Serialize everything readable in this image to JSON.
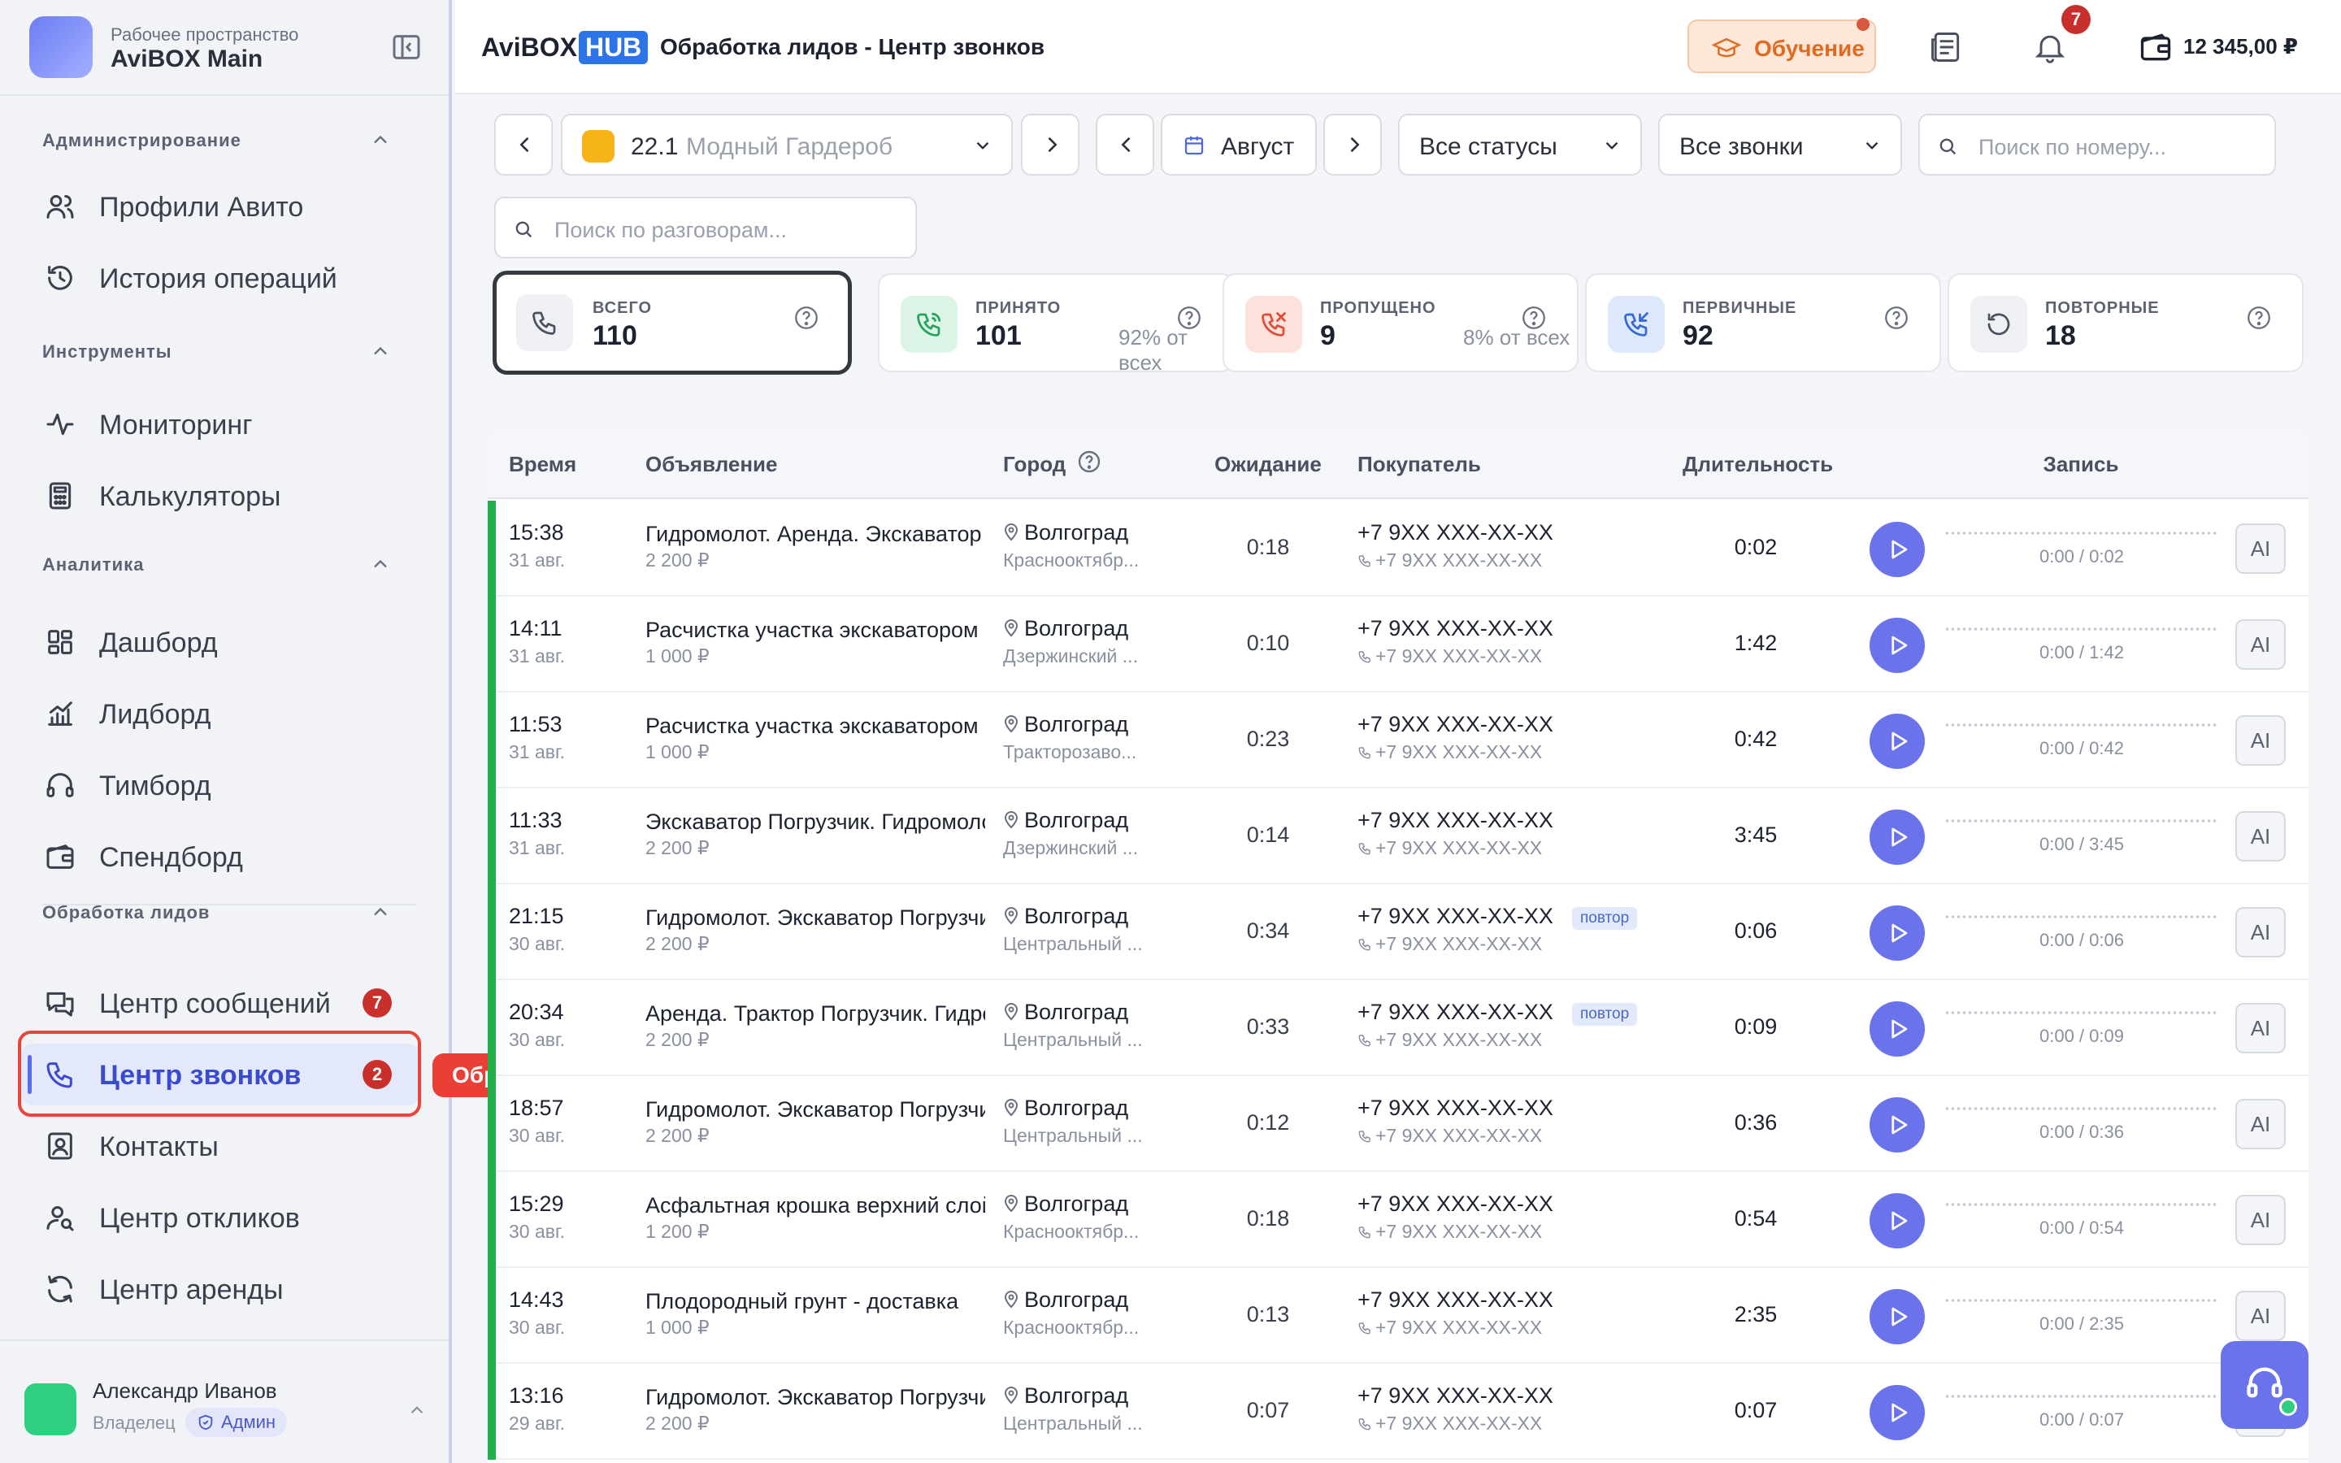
{
  "workspace": {
    "subtitle": "Рабочее пространство",
    "name": "AviBOX Main"
  },
  "sidebar": {
    "sections": [
      {
        "title": "Администрирование",
        "items": [
          {
            "label": "Профили Авито",
            "icon": "users-icon"
          },
          {
            "label": "История операций",
            "icon": "history-icon"
          }
        ]
      },
      {
        "title": "Инструменты",
        "items": [
          {
            "label": "Мониторинг",
            "icon": "activity-icon"
          },
          {
            "label": "Калькуляторы",
            "icon": "calculator-icon"
          }
        ]
      },
      {
        "title": "Аналитика",
        "items": [
          {
            "label": "Дашборд",
            "icon": "dashboard-icon"
          },
          {
            "label": "Лидборд",
            "icon": "chart-icon"
          },
          {
            "label": "Тимборд",
            "icon": "headphones-icon"
          },
          {
            "label": "Спендборд",
            "icon": "wallet-icon"
          }
        ]
      },
      {
        "title": "Обработка лидов",
        "items": [
          {
            "label": "Центр сообщений",
            "icon": "messages-icon",
            "badge": "7"
          },
          {
            "label": "Центр звонков",
            "icon": "phone-icon",
            "badge": "2",
            "active": true
          },
          {
            "label": "Контакты",
            "icon": "contacts-icon"
          },
          {
            "label": "Центр откликов",
            "icon": "user-search-icon"
          },
          {
            "label": "Центр аренды",
            "icon": "refresh-icon"
          }
        ]
      }
    ],
    "tooltip": "Обработка лидов → Звонки",
    "user": {
      "name": "Александр Иванов",
      "role": "Владелец",
      "badge": "Админ"
    }
  },
  "header": {
    "brand_left": "AviBOX",
    "brand_right": "HUB",
    "title": "Обработка лидов - Центр звонков",
    "learn_label": "Обучение",
    "notifications_count": "7",
    "balance": "12 345,00 ₽"
  },
  "filters": {
    "profile_code": "22.1",
    "profile_name": "Модный Гардероб",
    "month": "Август",
    "status": "Все статусы",
    "calls": "Все звонки",
    "phone_search_placeholder": "Поиск по номеру...",
    "conversation_search_placeholder": "Поиск по разговорам..."
  },
  "stats": [
    {
      "caption": "ВСЕГО",
      "value": "110",
      "pct": "",
      "color": "#eef0f4",
      "icon": "phone-icon",
      "iconColor": "#4a5060"
    },
    {
      "caption": "ПРИНЯТО",
      "value": "101",
      "pct": "92% от всех",
      "color": "#dcf5e6",
      "icon": "phone-in-icon",
      "iconColor": "#22a45a"
    },
    {
      "caption": "ПРОПУЩЕНО",
      "value": "9",
      "pct": "8% от всех",
      "color": "#fde2dc",
      "icon": "phone-missed-icon",
      "iconColor": "#e44b36"
    },
    {
      "caption": "ПЕРВИЧНЫЕ",
      "value": "92",
      "pct": "",
      "color": "#dde8fb",
      "icon": "phone-incoming-icon",
      "iconColor": "#3568d9"
    },
    {
      "caption": "ПОВТОРНЫЕ",
      "value": "18",
      "pct": "",
      "color": "#eef0f4",
      "icon": "repeat-icon",
      "iconColor": "#4a5060"
    }
  ],
  "table": {
    "columns": [
      "Время",
      "Объявление",
      "Город",
      "Ожидание",
      "Покупатель",
      "Длительность",
      "Запись"
    ],
    "ai_label": "AI",
    "repeat_label": "повтор",
    "rows": [
      {
        "time": "15:38",
        "date": "31 авг.",
        "ad": "Гидромолот. Аренда. Экскаватор",
        "price": "2 200 ₽",
        "city": "Волгоград",
        "district": "Краснооктябр...",
        "wait": "0:18",
        "phone": "+7 9XX XXX-XX-XX",
        "phone2": "+7 9XX XXX-XX-XX",
        "repeat": false,
        "duration": "0:02",
        "progress": "0:00 / 0:02"
      },
      {
        "time": "14:11",
        "date": "31 авг.",
        "ad": "Расчистка участка экскаватором",
        "price": "1 000 ₽",
        "city": "Волгоград",
        "district": "Дзержинский ...",
        "wait": "0:10",
        "phone": "+7 9XX XXX-XX-XX",
        "phone2": "+7 9XX XXX-XX-XX",
        "repeat": false,
        "duration": "1:42",
        "progress": "0:00 / 1:42"
      },
      {
        "time": "11:53",
        "date": "31 авг.",
        "ad": "Расчистка участка экскаватором",
        "price": "1 000 ₽",
        "city": "Волгоград",
        "district": "Тракторозаво...",
        "wait": "0:23",
        "phone": "+7 9XX XXX-XX-XX",
        "phone2": "+7 9XX XXX-XX-XX",
        "repeat": false,
        "duration": "0:42",
        "progress": "0:00 / 0:42"
      },
      {
        "time": "11:33",
        "date": "31 авг.",
        "ad": "Экскаватор Погрузчик. Гидромолот",
        "price": "2 200 ₽",
        "city": "Волгоград",
        "district": "Дзержинский ...",
        "wait": "0:14",
        "phone": "+7 9XX XXX-XX-XX",
        "phone2": "+7 9XX XXX-XX-XX",
        "repeat": false,
        "duration": "3:45",
        "progress": "0:00 / 3:45"
      },
      {
        "time": "21:15",
        "date": "30 авг.",
        "ad": "Гидромолот. Экскаватор Погрузчик",
        "price": "2 200 ₽",
        "city": "Волгоград",
        "district": "Центральный ...",
        "wait": "0:34",
        "phone": "+7 9XX XXX-XX-XX",
        "phone2": "+7 9XX XXX-XX-XX",
        "repeat": true,
        "duration": "0:06",
        "progress": "0:00 / 0:06"
      },
      {
        "time": "20:34",
        "date": "30 авг.",
        "ad": "Аренда. Трактор Погрузчик. Гидромолот",
        "price": "2 200 ₽",
        "city": "Волгоград",
        "district": "Центральный ...",
        "wait": "0:33",
        "phone": "+7 9XX XXX-XX-XX",
        "phone2": "+7 9XX XXX-XX-XX",
        "repeat": true,
        "duration": "0:09",
        "progress": "0:00 / 0:09"
      },
      {
        "time": "18:57",
        "date": "30 авг.",
        "ad": "Гидромолот. Экскаватор Погрузчик",
        "price": "2 200 ₽",
        "city": "Волгоград",
        "district": "Центральный ...",
        "wait": "0:12",
        "phone": "+7 9XX XXX-XX-XX",
        "phone2": "+7 9XX XXX-XX-XX",
        "repeat": false,
        "duration": "0:36",
        "progress": "0:00 / 0:36"
      },
      {
        "time": "15:29",
        "date": "30 авг.",
        "ad": "Асфальтная крошка верхний слой",
        "price": "1 200 ₽",
        "city": "Волгоград",
        "district": "Краснооктябр...",
        "wait": "0:18",
        "phone": "+7 9XX XXX-XX-XX",
        "phone2": "+7 9XX XXX-XX-XX",
        "repeat": false,
        "duration": "0:54",
        "progress": "0:00 / 0:54"
      },
      {
        "time": "14:43",
        "date": "30 авг.",
        "ad": "Плодородный грунт - доставка",
        "price": "1 000 ₽",
        "city": "Волгоград",
        "district": "Краснооктябр...",
        "wait": "0:13",
        "phone": "+7 9XX XXX-XX-XX",
        "phone2": "+7 9XX XXX-XX-XX",
        "repeat": false,
        "duration": "2:35",
        "progress": "0:00 / 2:35"
      },
      {
        "time": "13:16",
        "date": "29 авг.",
        "ad": "Гидромолот. Экскаватор Погрузчик",
        "price": "2 200 ₽",
        "city": "Волгоград",
        "district": "Центральный ...",
        "wait": "0:07",
        "phone": "+7 9XX XXX-XX-XX",
        "phone2": "+7 9XX XXX-XX-XX",
        "repeat": false,
        "duration": "0:07",
        "progress": "0:00 / 0:07"
      }
    ]
  }
}
